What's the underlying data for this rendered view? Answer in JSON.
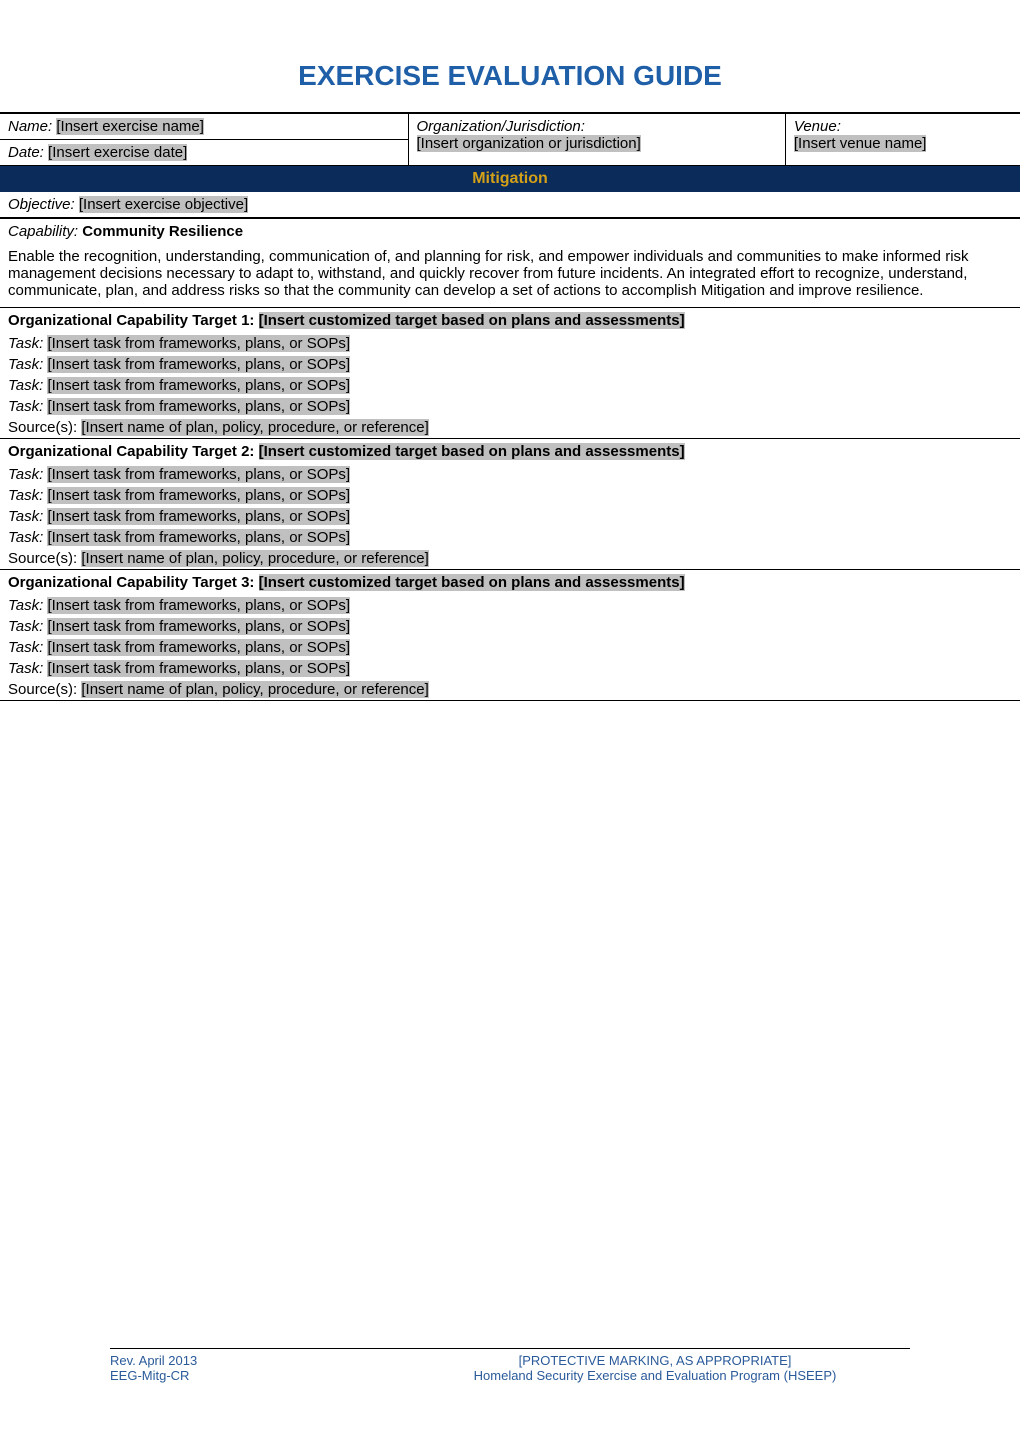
{
  "title": "EXERCISE EVALUATION GUIDE",
  "header": {
    "nameLabel": "Name:",
    "namePlaceholder": "[Insert exercise name]",
    "dateLabel": "Date:",
    "datePlaceholder": "[Insert exercise date]",
    "orgLabel": "Organization/Jurisdiction:",
    "orgPlaceholder": "[Insert organization or jurisdiction]",
    "venueLabel": "Venue:",
    "venuePlaceholder": "[Insert venue name]"
  },
  "mitigationBanner": "Mitigation",
  "objective": {
    "label": "Objective:",
    "placeholder": "[Insert exercise objective]"
  },
  "capability": {
    "label": "Capability:",
    "name": "Community Resilience",
    "description": "Enable the recognition, understanding, communication of, and planning for risk, and empower individuals and communities to make informed risk management decisions necessary to adapt to, withstand, and quickly recover from future incidents. An integrated effort to recognize, understand, communicate, plan, and address risks so that the community can develop a set of actions to accomplish Mitigation and improve resilience."
  },
  "targets": [
    {
      "titlePrefix": "Organizational Capability Target 1:  ",
      "titlePlaceholder": "[Insert customized target based on plans and assessments]",
      "tasks": [
        {
          "label": "Task:",
          "placeholder": "[Insert task from frameworks, plans, or SOPs]"
        },
        {
          "label": "Task:",
          "placeholder": "[Insert task from frameworks, plans, or SOPs]"
        },
        {
          "label": "Task:",
          "placeholder": "[Insert task from frameworks, plans, or SOPs]"
        },
        {
          "label": "Task:",
          "placeholder": "[Insert task from frameworks, plans, or SOPs]"
        }
      ],
      "sourceLabel": "Source(s):",
      "sourcePlaceholder": "[Insert name of plan, policy, procedure, or reference]"
    },
    {
      "titlePrefix": "Organizational Capability Target 2:  ",
      "titlePlaceholder": "[Insert customized target based on plans and assessments]",
      "tasks": [
        {
          "label": "Task:",
          "placeholder": "[Insert task from frameworks, plans, or SOPs]"
        },
        {
          "label": "Task:",
          "placeholder": "[Insert task from frameworks, plans, or SOPs]"
        },
        {
          "label": "Task:",
          "placeholder": "[Insert task from frameworks, plans, or SOPs]"
        },
        {
          "label": "Task:",
          "placeholder": "[Insert task from frameworks, plans, or SOPs]"
        }
      ],
      "sourceLabel": "Source(s):",
      "sourcePlaceholder": "[Insert name of plan, policy, procedure, or reference]"
    },
    {
      "titlePrefix": "Organizational Capability Target 3:  ",
      "titlePlaceholder": "[Insert customized target based on plans and assessments]",
      "tasks": [
        {
          "label": "Task:",
          "placeholder": "[Insert task from frameworks, plans, or SOPs]"
        },
        {
          "label": "Task:",
          "placeholder": "[Insert task from frameworks, plans, or SOPs]"
        },
        {
          "label": "Task:",
          "placeholder": "[Insert task from frameworks, plans, or SOPs]"
        },
        {
          "label": "Task:",
          "placeholder": "[Insert task from frameworks, plans, or SOPs]"
        }
      ],
      "sourceLabel": "Source(s):",
      "sourcePlaceholder": "[Insert name of plan, policy, procedure, or reference]"
    }
  ],
  "footer": {
    "revDate": "Rev. April 2013",
    "protectiveMarking": "[PROTECTIVE MARKING, AS APPROPRIATE]",
    "code": "EEG-Mitg-CR",
    "program": "Homeland Security Exercise and Evaluation Program (HSEEP)"
  }
}
